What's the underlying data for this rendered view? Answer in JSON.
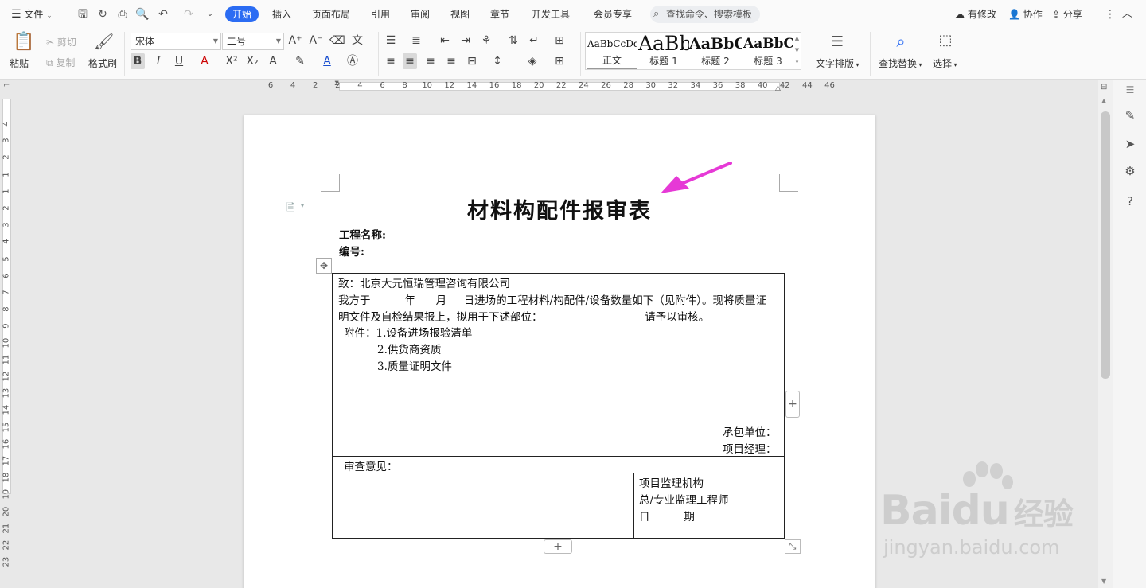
{
  "menubar": {
    "file_label": "文件",
    "tabs": [
      {
        "label": "开始"
      },
      {
        "label": "插入"
      },
      {
        "label": "页面布局"
      },
      {
        "label": "引用"
      },
      {
        "label": "审阅"
      },
      {
        "label": "视图"
      },
      {
        "label": "章节"
      },
      {
        "label": "开发工具"
      },
      {
        "label": "会员专享"
      }
    ],
    "search_placeholder": "查找命令、搜索模板",
    "right": {
      "modified": "有修改",
      "collab": "协作",
      "share": "分享"
    }
  },
  "toolbar": {
    "paste": "粘贴",
    "cut": "剪切",
    "copy": "复制",
    "format_painter": "格式刷",
    "font_name": "宋体",
    "font_size": "二号",
    "styles": [
      {
        "preview": "AaBbCcDd",
        "label": "正文"
      },
      {
        "preview": "AaBb",
        "label": "标题 1"
      },
      {
        "preview": "AaBbC",
        "label": "标题 2"
      },
      {
        "preview": "AaBbC",
        "label": "标题 3"
      }
    ],
    "text_layout": "文字排版",
    "find_replace": "查找替换",
    "select": "选择"
  },
  "ruler": {
    "top": [
      "6",
      "4",
      "2",
      "2",
      "4",
      "6",
      "8",
      "10",
      "12",
      "14",
      "16",
      "18",
      "20",
      "22",
      "24",
      "26",
      "28",
      "30",
      "32",
      "34",
      "36",
      "38",
      "40",
      "42",
      "44",
      "46"
    ],
    "left": [
      "4",
      "3",
      "2",
      "1",
      "1",
      "2",
      "3",
      "4",
      "5",
      "6",
      "7",
      "8",
      "9",
      "10",
      "11",
      "12",
      "13",
      "14",
      "15",
      "16",
      "17",
      "18",
      "19",
      "20",
      "21",
      "22",
      "23"
    ]
  },
  "document": {
    "title": "材料构配件报审表",
    "project_name": "工程名称:",
    "number": "编号:",
    "to": "致：北京大元恒瑞管理咨询有限公司",
    "body1": "我方于          年      月     日进场的工程材料/构配件/设备数量如下（见附件）。现将质量证",
    "body2": "明文件及自检结果报上，拟用于下述部位：                              请予以审核。",
    "attach_head": "附件：1.设备进场报验清单",
    "attach2": "2.供货商资质",
    "attach3": "3.质量证明文件",
    "contractor": "承包单位：",
    "pm": "项目经理：",
    "review": "审查意见：",
    "sup_org": "项目监理机构",
    "sup_eng": "总/专业监理工程师",
    "date": "日          期"
  },
  "watermark": {
    "brand": "Bai",
    "brand2": "du",
    "cn": "经验",
    "url": "jingyan.baidu.com"
  }
}
